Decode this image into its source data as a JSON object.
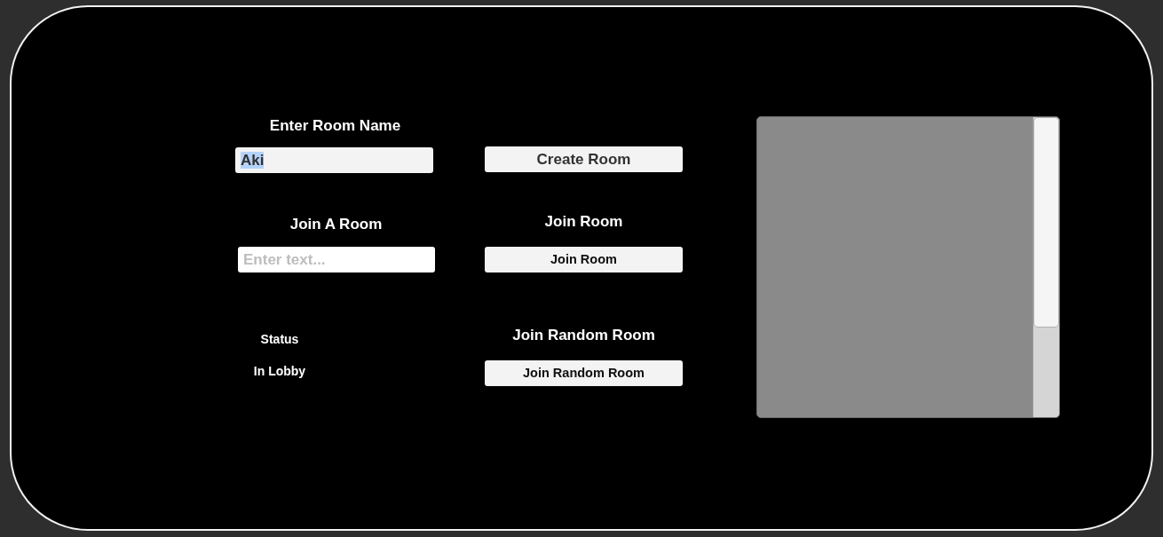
{
  "create": {
    "label": "Enter Room Name",
    "field": {
      "value": "Aki",
      "text_selected": true
    },
    "button": "Create Room"
  },
  "join": {
    "label": "Join A Room",
    "field": {
      "placeholder": "Enter text...",
      "text_selected": false
    },
    "heading": "Join Room",
    "button": "Join Room"
  },
  "random": {
    "heading": "Join Random Room",
    "button": "Join Random Room"
  },
  "status": {
    "label": "Status",
    "value": "In Lobby"
  }
}
